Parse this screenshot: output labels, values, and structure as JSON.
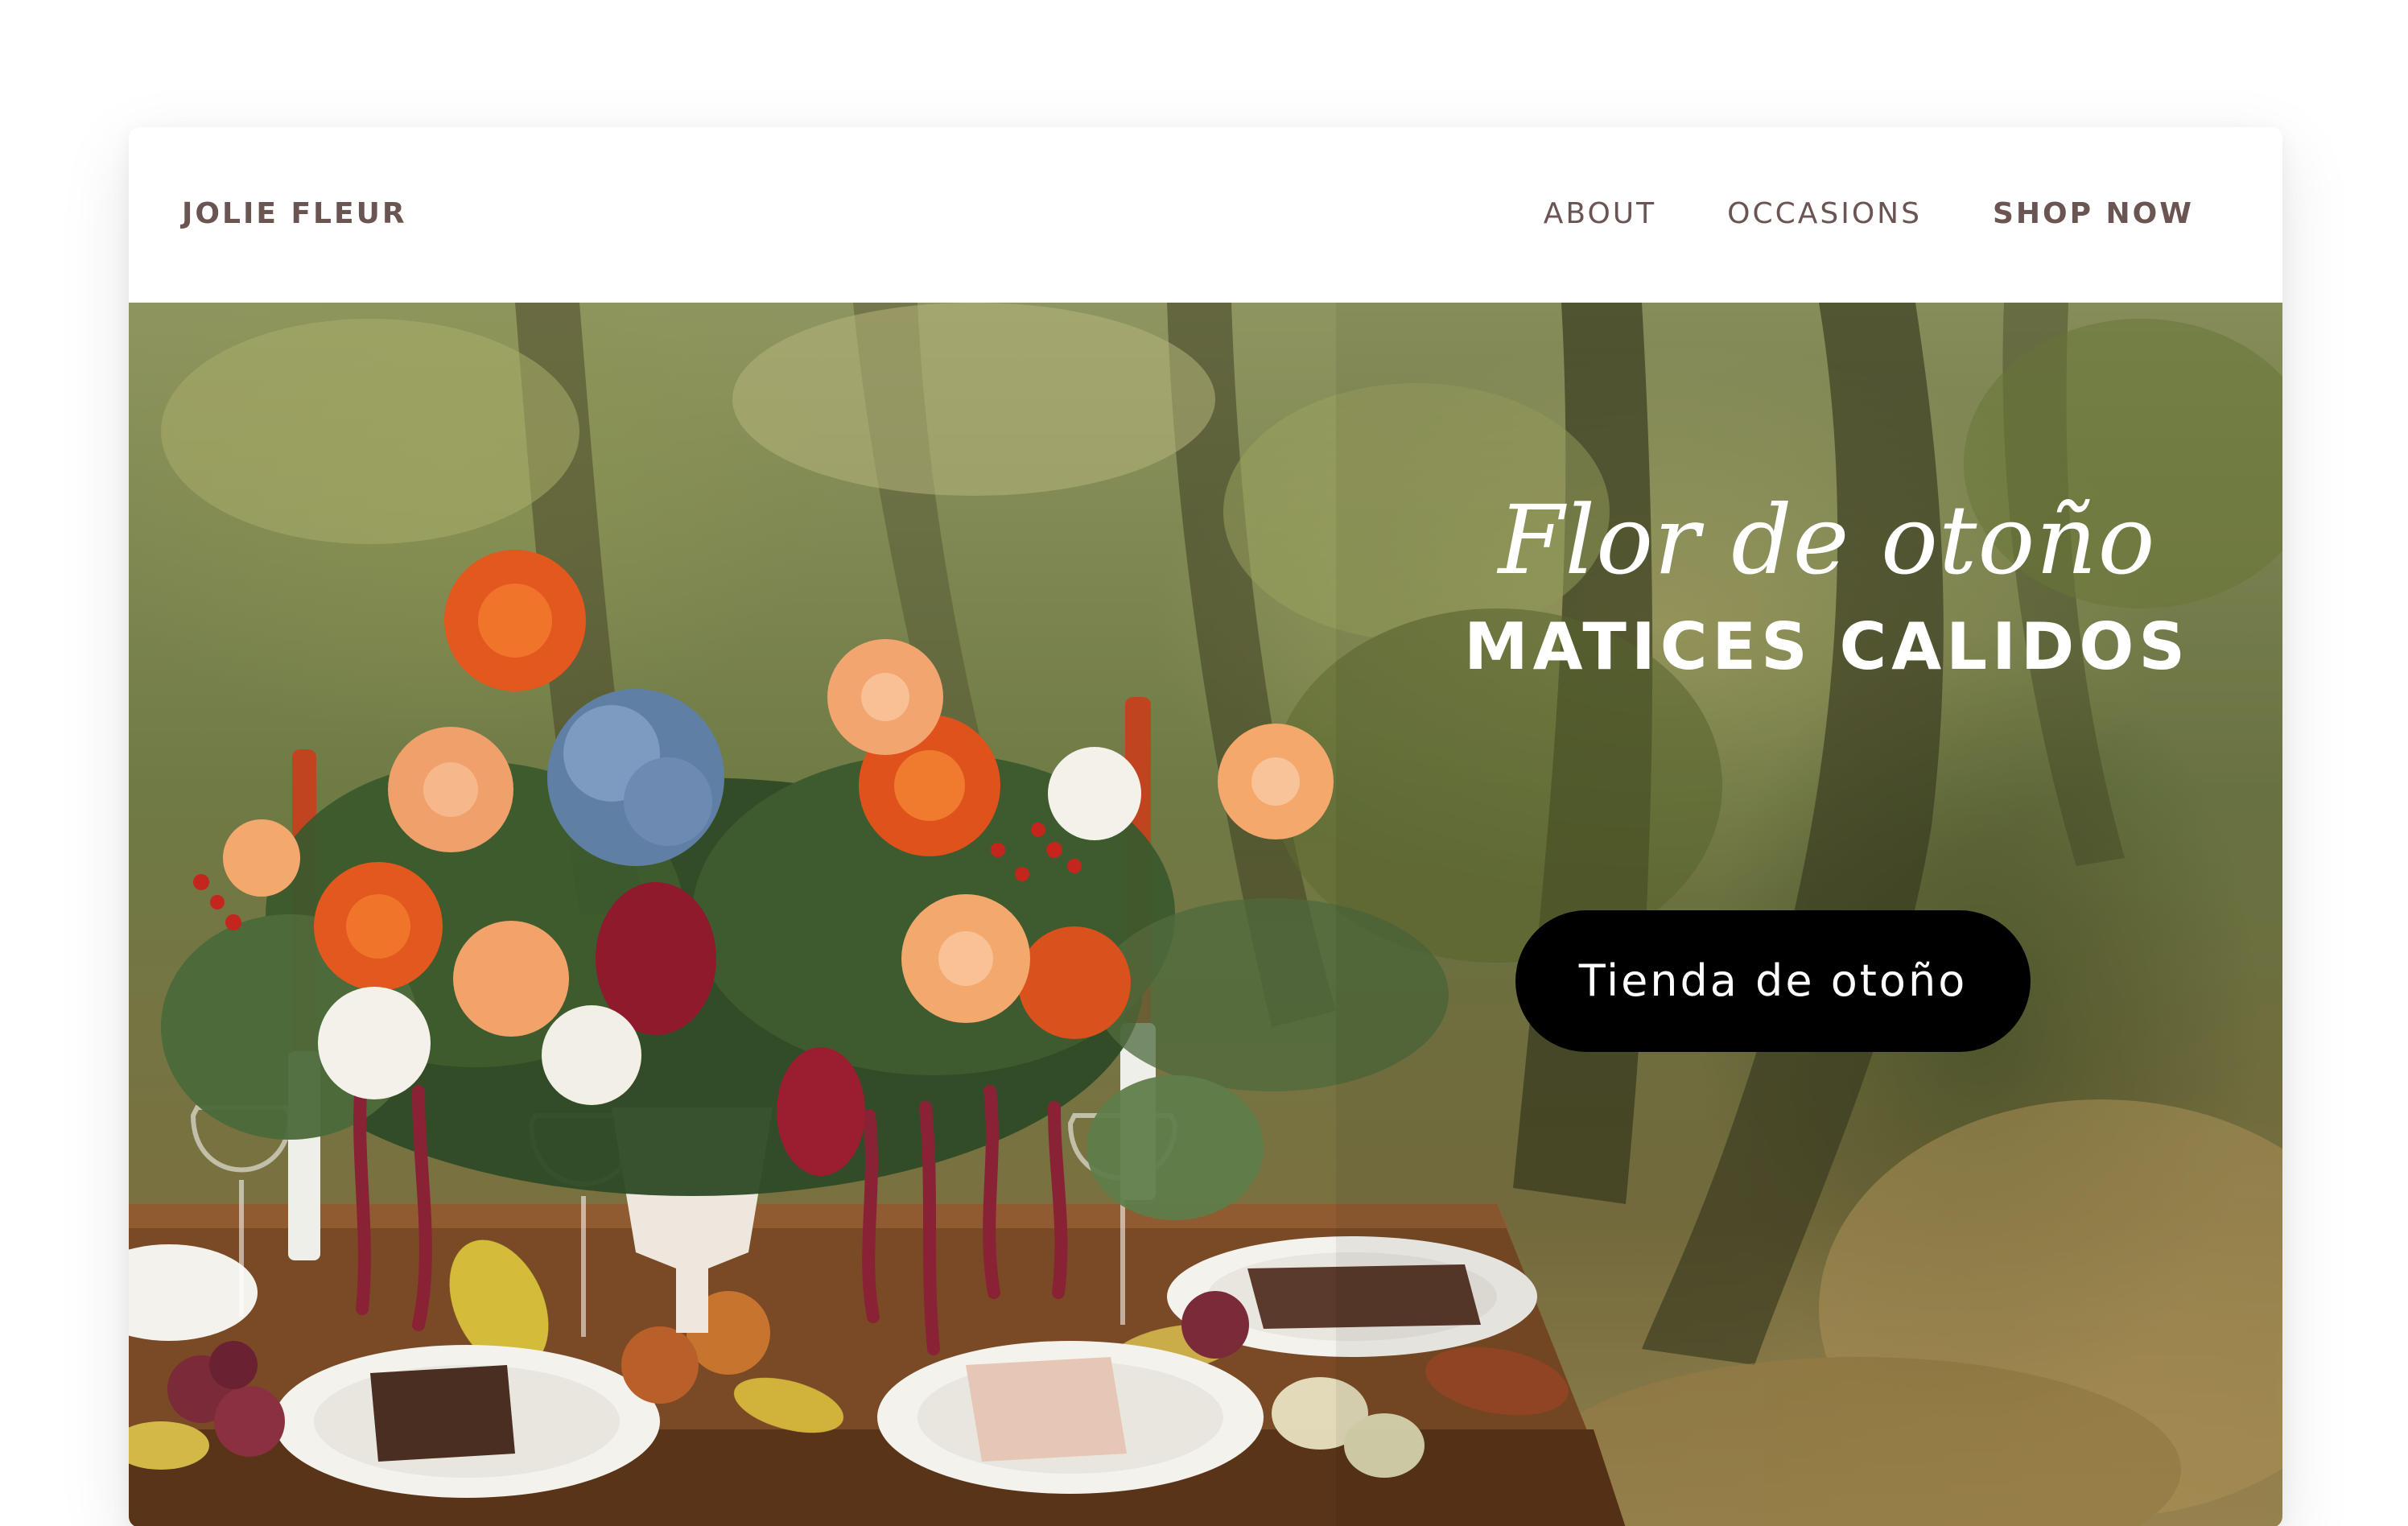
{
  "brand": {
    "name": "JOLIE FLEUR"
  },
  "nav": {
    "items": [
      {
        "label": "ABOUT"
      },
      {
        "label": "OCCASIONS"
      },
      {
        "label": "SHOP NOW"
      }
    ]
  },
  "hero": {
    "script_title": "Flor de otoño",
    "headline": "MATICES CALIDOS",
    "cta_label": "Tienda de otoño",
    "image": "autumn-floral-table-arrangement-photo"
  },
  "colors": {
    "nav_text": "#6b5553",
    "cta_background": "#000000",
    "hero_text": "#ffffff"
  }
}
